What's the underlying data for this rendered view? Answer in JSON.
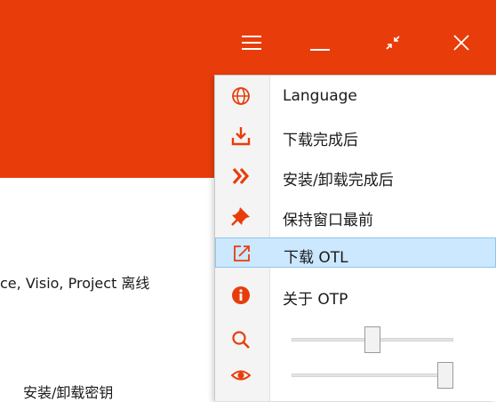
{
  "colors": {
    "title_bar": "#E83D0B",
    "accent_icon": "#E83D0B",
    "highlight_bg": "#cce8ff",
    "highlight_border": "#8fc4ea"
  },
  "title_bar": {
    "buttons": [
      {
        "name": "menu",
        "icon": "hamburger-icon"
      },
      {
        "name": "minimize",
        "icon": "minimize-icon"
      },
      {
        "name": "compact",
        "icon": "collapse-arrows-icon"
      },
      {
        "name": "close",
        "icon": "close-icon"
      }
    ]
  },
  "background": {
    "products_text": "ce, Visio, Project 离线",
    "key_text": "安装/卸载密钥"
  },
  "menu": {
    "items": [
      {
        "label": "Language",
        "icon": "globe-icon",
        "highlighted": false
      },
      {
        "label": "下载完成后",
        "icon": "download-icon",
        "highlighted": false
      },
      {
        "label": "安装/卸载完成后",
        "icon": "double-chevron-right-icon",
        "highlighted": false
      },
      {
        "label": "保持窗口最前",
        "icon": "pin-icon",
        "highlighted": false
      },
      {
        "label": "下载 OTL",
        "icon": "external-link-icon",
        "highlighted": true
      },
      {
        "label": "关于 OTP",
        "icon": "info-icon",
        "highlighted": false
      }
    ],
    "sliders": [
      {
        "name": "zoom",
        "icon": "magnifier-icon",
        "value": 0.5
      },
      {
        "name": "opacity",
        "icon": "eye-icon",
        "value": 1.0
      }
    ]
  }
}
